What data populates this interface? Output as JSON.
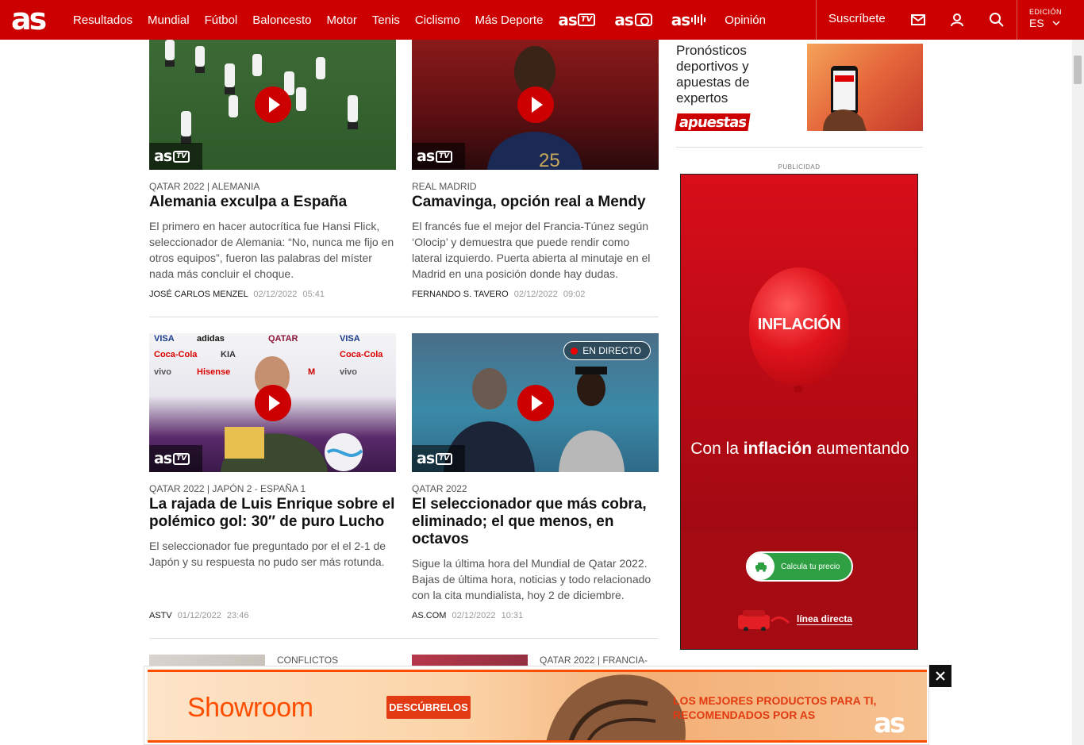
{
  "nav": {
    "logo": "as",
    "items": [
      "Resultados",
      "Mundial",
      "Fútbol",
      "Baloncesto",
      "Motor",
      "Tenis",
      "Ciclismo",
      "Más Deporte"
    ],
    "brands": {
      "tv": "as",
      "tv_suffix": "TV",
      "photo": "as",
      "audio": "as"
    },
    "opinion": "Opinión",
    "subscribe": "Suscríbete",
    "edition_label": "EDICIÓN",
    "edition_value": "ES"
  },
  "articles": [
    {
      "kicker": "QATAR 2022 | ALEMANIA",
      "headline": "Alemania exculpa a España",
      "summary": "El primero en hacer autocrítica fue Hansi Flick, seleccionador de Alemania: “No, nunca me fijo en otros equipos”, fueron las palabras del míster nada más concluir el choque.",
      "author": "JOSÉ CARLOS MENZEL",
      "date": "02/12/2022",
      "time": "05:41",
      "badge": "as"
    },
    {
      "kicker": "REAL MADRID",
      "headline": "Camavinga, opción real a Mendy",
      "summary": "El francés fue el mejor del Francia-Túnez según ‘Olocip’ y demuestra que puede rendir como lateral izquierdo. Puerta abierta al minutaje en el Madrid en una posición donde hay dudas.",
      "author": "FERNANDO S. TAVERO",
      "date": "02/12/2022",
      "time": "09:02",
      "badge": "as"
    },
    {
      "kicker": "QATAR 2022 | JAPÓN 2 - ESPAÑA 1",
      "headline": "La rajada de Luis Enrique sobre el polémico gol: 30″ de puro Lucho",
      "summary": "El seleccionador fue preguntado por el el 2-1 de Japón y su respuesta no pudo ser más rotunda.",
      "author": "ASTV",
      "date": "01/12/2022",
      "time": "23:46",
      "badge": "as"
    },
    {
      "kicker": "QATAR 2022",
      "headline": "El seleccionador que más cobra, eliminado; el que menos, en octavos",
      "summary": "Sigue la última hora del Mundial de Qatar 2022. Bajas de última hora, noticias y todo relacionado con la cita mundialista, hoy 2 de diciembre.",
      "author": "AS.COM",
      "date": "02/12/2022",
      "time": "10:31",
      "badge": "as",
      "live_label": "EN DIRECTO"
    }
  ],
  "small_cards": [
    {
      "kicker": "CONFLICTOS"
    },
    {
      "kicker": "QATAR 2022 | FRANCIA-"
    }
  ],
  "sidebar": {
    "promo_text": "Pronósticos deportivos y apuestas de expertos",
    "promo_logo": "apuestas",
    "ad_label": "PUBLICIDAD",
    "ad": {
      "balloon_text": "INFLACIÓN",
      "tagline_pre": "Con la ",
      "tagline_bold": "inflación",
      "tagline_post": " aumentando",
      "cta": "Calcula tu precio",
      "brand": "línea directa"
    }
  },
  "banner": {
    "brand": "Showroom",
    "button": "DESCÚBRELOS",
    "copy": "LOS MEJORES PRODUCTOS PARA TI, RECOMENDADOS POR AS",
    "logo": "as"
  },
  "colors": {
    "brand_red": "#cc0000",
    "banner_orange": "#ff4d00",
    "cta_green": "#2ea043"
  }
}
